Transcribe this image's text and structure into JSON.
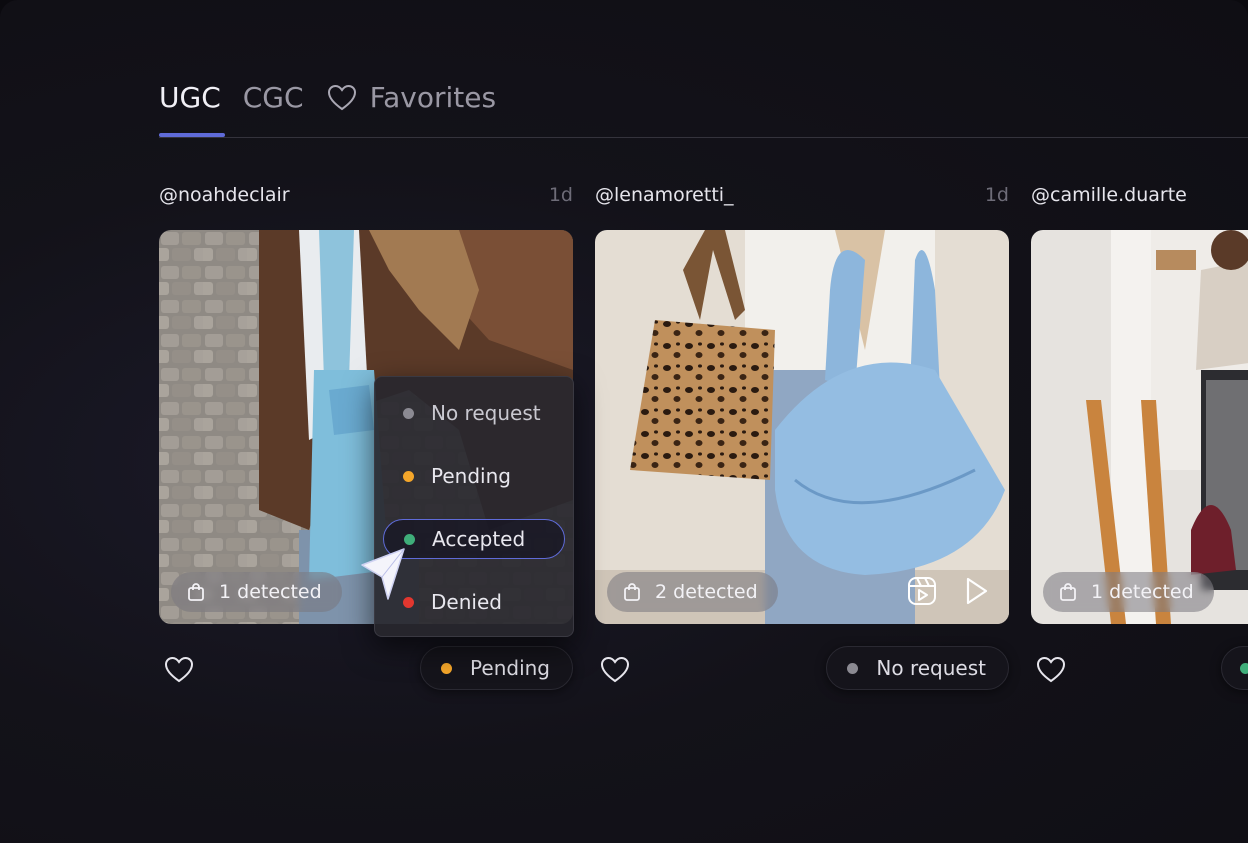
{
  "tabs": [
    {
      "label": "UGC",
      "active": true
    },
    {
      "label": "CGC",
      "active": false
    },
    {
      "label": "Favorites",
      "active": false,
      "icon": "heart-icon"
    }
  ],
  "colors": {
    "accent": "#5f6bd8",
    "pending": "#f4a62a",
    "accepted": "#3fae7a",
    "denied": "#e2372f",
    "no_request": "#8b8a92"
  },
  "cards": [
    {
      "handle": "@noahdeclair",
      "age": "1d",
      "detected": "1 detected",
      "status": "Pending",
      "status_color": "#f4a62a",
      "icons": [
        "reel-icon",
        "play-icon"
      ]
    },
    {
      "handle": "@lenamoretti_",
      "age": "1d",
      "detected": "2 detected",
      "status": "No request",
      "status_color": "#8b8a92",
      "icons": [
        "reel-icon",
        "play-icon"
      ]
    },
    {
      "handle": "@camille.duarte",
      "age": "",
      "detected": "1 detected",
      "status": "",
      "status_color": "#3fae7a",
      "icons": []
    }
  ],
  "dropdown": {
    "options": [
      {
        "label": "No request",
        "color": "#8b8a92"
      },
      {
        "label": "Pending",
        "color": "#f4a62a"
      },
      {
        "label": "Accepted",
        "color": "#3fae7a",
        "selected": true
      },
      {
        "label": "Denied",
        "color": "#e2372f"
      }
    ]
  }
}
